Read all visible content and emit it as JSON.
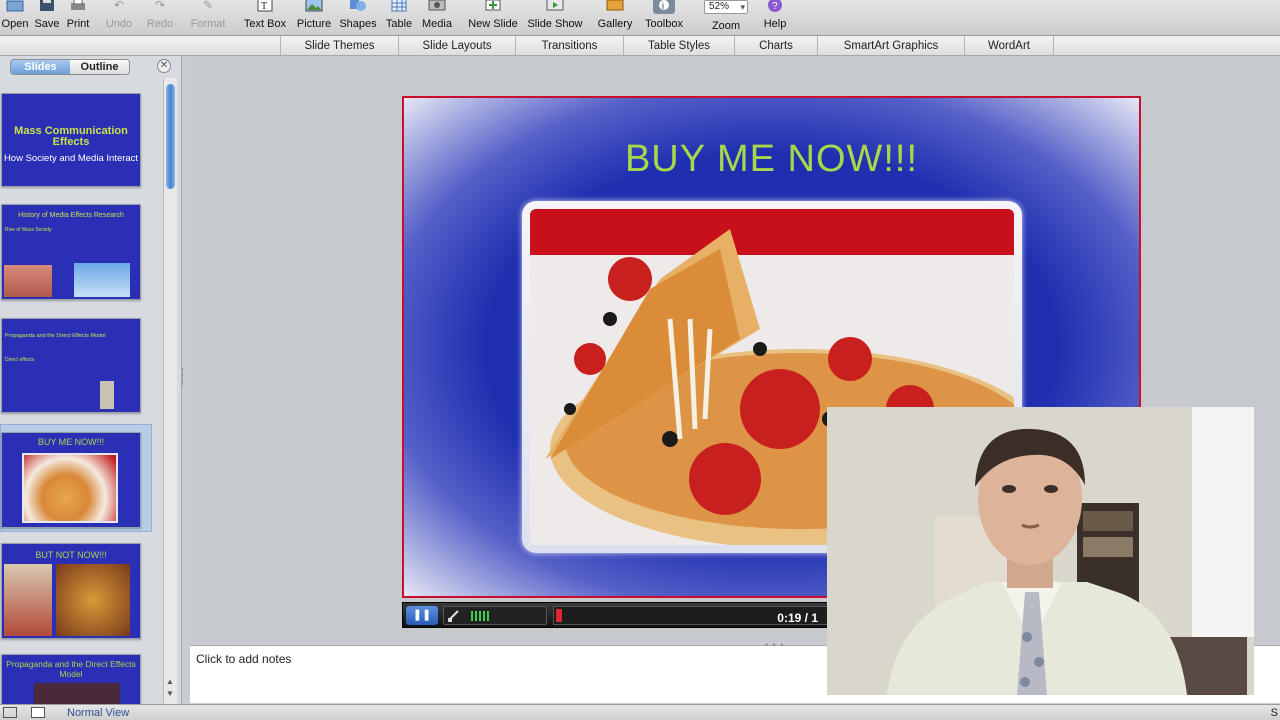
{
  "toolbar": {
    "items": [
      {
        "label": "Open",
        "icon": "folder-open-icon",
        "enabled": true
      },
      {
        "label": "Save",
        "icon": "floppy-disk-icon",
        "enabled": true
      },
      {
        "label": "Print",
        "icon": "printer-icon",
        "enabled": true
      },
      {
        "label": "Undo",
        "icon": "undo-icon",
        "enabled": false
      },
      {
        "label": "Redo",
        "icon": "redo-icon",
        "enabled": false
      },
      {
        "label": "Format",
        "icon": "paintbrush-icon",
        "enabled": false
      },
      {
        "label": "Text Box",
        "icon": "text-box-icon",
        "enabled": true
      },
      {
        "label": "Picture",
        "icon": "picture-icon",
        "enabled": true
      },
      {
        "label": "Shapes",
        "icon": "shapes-icon",
        "enabled": true
      },
      {
        "label": "Table",
        "icon": "table-icon",
        "enabled": true
      },
      {
        "label": "Media",
        "icon": "media-icon",
        "enabled": true
      },
      {
        "label": "New Slide",
        "icon": "new-slide-icon",
        "enabled": true
      },
      {
        "label": "Slide Show",
        "icon": "slide-show-icon",
        "enabled": true
      },
      {
        "label": "Gallery",
        "icon": "gallery-icon",
        "enabled": true
      },
      {
        "label": "Toolbox",
        "icon": "toolbox-icon",
        "enabled": true
      },
      {
        "label": "Zoom",
        "icon": "zoom-icon",
        "enabled": true
      },
      {
        "label": "Help",
        "icon": "help-icon",
        "enabled": true
      }
    ],
    "zoom_value": "52%"
  },
  "ribbon_tabs": [
    "Slide Themes",
    "Slide Layouts",
    "Transitions",
    "Table Styles",
    "Charts",
    "SmartArt Graphics",
    "WordArt"
  ],
  "left_panel": {
    "tabs": [
      "Slides",
      "Outline"
    ],
    "active_tab": "Slides",
    "thumbnails": [
      {
        "title": "Mass Communication Effects",
        "subtitle": "How Society and Media Interact"
      },
      {
        "title": "History of Media Effects Research",
        "subtitle": "Rise of Mass Society"
      },
      {
        "title": "Propaganda and the Direct Effects Model",
        "subtitle": "Direct effects"
      },
      {
        "title": "BUY ME NOW!!!",
        "subtitle": ""
      },
      {
        "title": "BUT NOT NOW!!!",
        "subtitle": ""
      },
      {
        "title": "Propaganda and the Direct Effects Model",
        "subtitle": ""
      }
    ],
    "selected_index": 3
  },
  "slide": {
    "title": "BUY ME NOW!!!",
    "title_color": "#a8d84a",
    "border_color": "#c8102e"
  },
  "media_controls": {
    "time": "0:19 / 1",
    "progress": 0.02
  },
  "notes": {
    "placeholder": "Click to add notes"
  },
  "status": {
    "view": "Normal View",
    "right_glyph": "S"
  }
}
